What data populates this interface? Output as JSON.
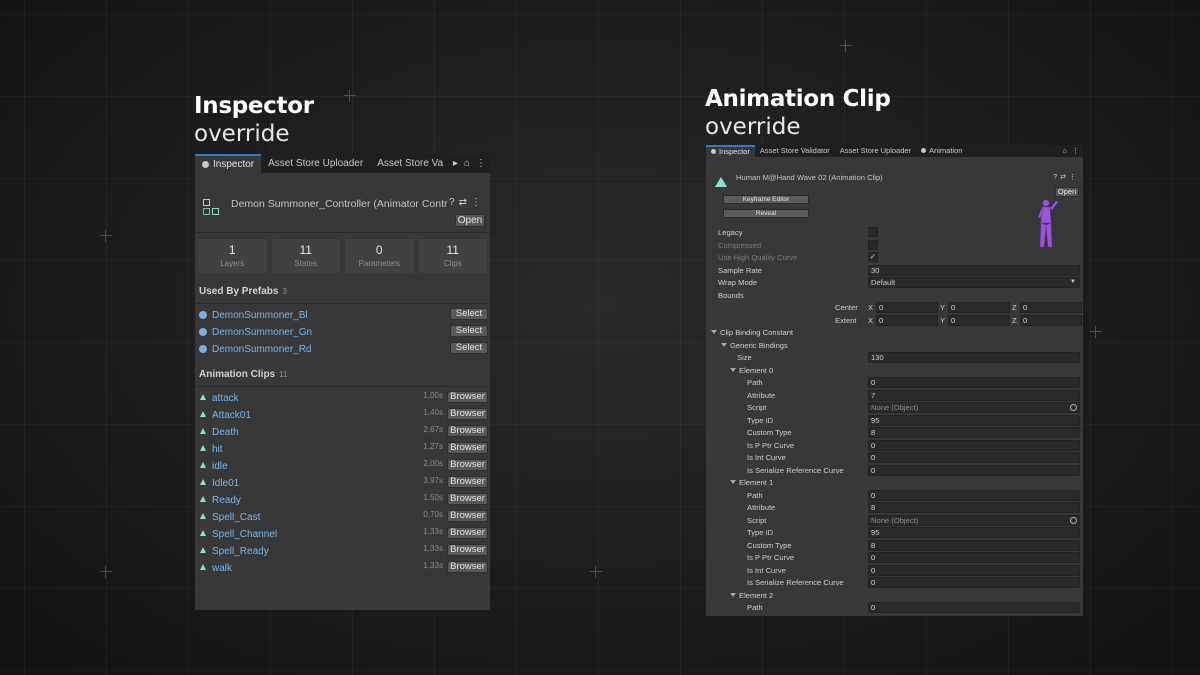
{
  "left_heading": {
    "title": "Inspector",
    "subtitle": "override"
  },
  "right_heading": {
    "title": "Animation Clip",
    "subtitle": "override"
  },
  "left_panel": {
    "tabs": [
      "Inspector",
      "Asset Store Uploader",
      "Asset Store Va"
    ],
    "title": "Demon Summoner_Controller (Animator Contr",
    "open_label": "Open",
    "stats": [
      {
        "value": "1",
        "label": "Layers"
      },
      {
        "value": "11",
        "label": "States"
      },
      {
        "value": "0",
        "label": "Parameters"
      },
      {
        "value": "11",
        "label": "Clips"
      }
    ],
    "prefabs_title": "Used By Prefabs",
    "prefabs_count": "3",
    "prefabs": [
      {
        "name": "DemonSummoner_Bl",
        "button": "Select"
      },
      {
        "name": "DemonSummoner_Gn",
        "button": "Select"
      },
      {
        "name": "DemonSummoner_Rd",
        "button": "Select"
      }
    ],
    "clips_title": "Animation Clips",
    "clips_count": "11",
    "clips": [
      {
        "name": "attack",
        "duration": "1,00s",
        "button": "Browser"
      },
      {
        "name": "Attack01",
        "duration": "1,40s",
        "button": "Browser"
      },
      {
        "name": "Death",
        "duration": "2,67s",
        "button": "Browser"
      },
      {
        "name": "hit",
        "duration": "1,27s",
        "button": "Browser"
      },
      {
        "name": "idle",
        "duration": "2,00s",
        "button": "Browser"
      },
      {
        "name": "Idle01",
        "duration": "3,97s",
        "button": "Browser"
      },
      {
        "name": "Ready",
        "duration": "1,50s",
        "button": "Browser"
      },
      {
        "name": "Spell_Cast",
        "duration": "0,70s",
        "button": "Browser"
      },
      {
        "name": "Spell_Channel",
        "duration": "1,33s",
        "button": "Browser"
      },
      {
        "name": "Spell_Ready",
        "duration": "1,33s",
        "button": "Browser"
      },
      {
        "name": "walk",
        "duration": "1,33s",
        "button": "Browser"
      }
    ]
  },
  "right_panel": {
    "tabs": [
      "Inspector",
      "Asset Store Validator",
      "Asset Store Uploader",
      "Animation"
    ],
    "title": "Human M@Hand Wave 02 (Animation Clip)",
    "open_label": "Open",
    "keyframe_editor": "Keyframe Editor",
    "reveal": "Reveal",
    "legacy": "Legacy",
    "compressed": "Compressed",
    "high_quality": "Use High Quality Curve",
    "sample_rate_label": "Sample Rate",
    "sample_rate": "30",
    "wrap_mode_label": "Wrap Mode",
    "wrap_mode": "Default",
    "bounds": "Bounds",
    "center": "Center",
    "extent": "Extent",
    "axis_x": "X",
    "axis_y": "Y",
    "axis_z": "Z",
    "center_values": [
      "0",
      "0",
      "0"
    ],
    "extent_values": [
      "0",
      "0",
      "0"
    ],
    "clip_binding": "Clip Binding Constant",
    "generic_bindings": "Generic Bindings",
    "size_label": "Size",
    "size": "130",
    "field_labels": {
      "path": "Path",
      "attribute": "Attribute",
      "script": "Script",
      "type_id": "Type ID",
      "custom_type": "Custom Type",
      "is_pptr": "Is P Ptr Curve",
      "is_int": "Is Int Curve",
      "is_serialize": "Is Serialize Reference Curve"
    },
    "elements": [
      {
        "name": "Element 0",
        "path": "0",
        "attribute": "7",
        "script": "None (Object)",
        "type_id": "95",
        "custom_type": "8",
        "is_pptr": "0",
        "is_int": "0",
        "is_serialize": "0"
      },
      {
        "name": "Element 1",
        "path": "0",
        "attribute": "8",
        "script": "None (Object)",
        "type_id": "95",
        "custom_type": "8",
        "is_pptr": "0",
        "is_int": "0",
        "is_serialize": "0"
      },
      {
        "name": "Element 2",
        "path": "0"
      }
    ]
  }
}
